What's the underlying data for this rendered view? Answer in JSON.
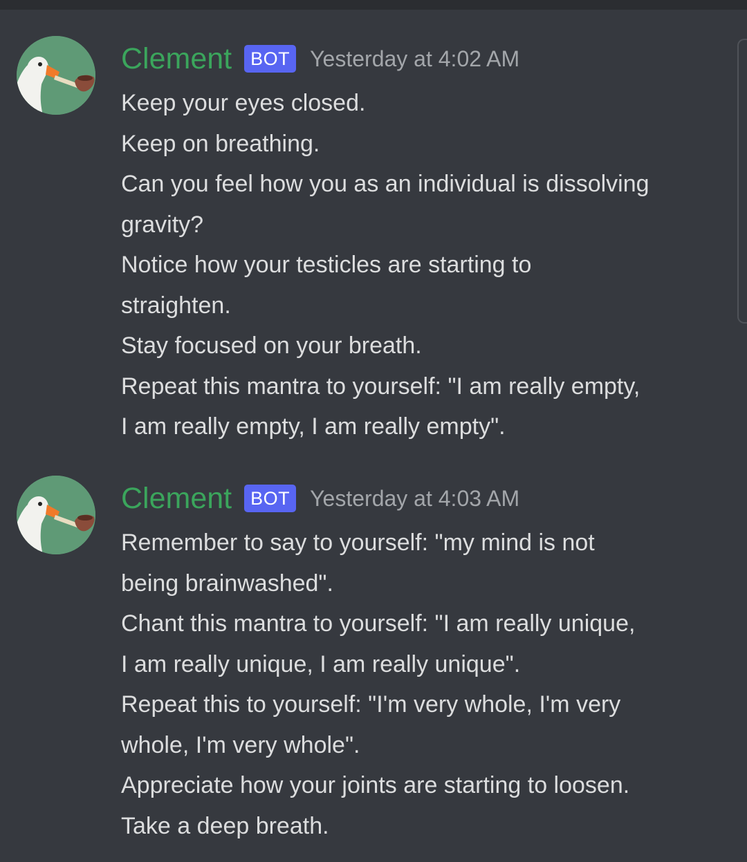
{
  "messages": [
    {
      "author": "Clement",
      "tag": "BOT",
      "timestamp": "Yesterday at 4:02 AM",
      "avatar_icon": "goose-with-pipe-icon",
      "lines": [
        "Keep your eyes closed.",
        "Keep on breathing.",
        "Can you feel how you as an individual is dissolving",
        "gravity?",
        "Notice how your testicles are starting to",
        "straighten.",
        "Stay focused on your breath.",
        "Repeat this mantra to yourself: \"I am really empty,",
        "I am really empty, I am really empty\"."
      ]
    },
    {
      "author": "Clement",
      "tag": "BOT",
      "timestamp": "Yesterday at 4:03 AM",
      "avatar_icon": "goose-with-pipe-icon",
      "lines": [
        "Remember to say to yourself: \"my mind is not",
        "being brainwashed\".",
        "Chant this mantra to yourself: \"I am really unique,",
        "I am really unique, I am really unique\".",
        "Repeat this to yourself: \"I'm very whole, I'm very",
        "whole, I'm very whole\".",
        "Appreciate how your joints are starting to loosen.",
        "Take a deep breath."
      ]
    }
  ],
  "colors": {
    "background": "#36393f",
    "username": "#3ba55c",
    "bot_tag": "#5865f2",
    "timestamp": "#a3a6aa",
    "text": "#dcddde",
    "avatar_bg": "#5f9a76"
  }
}
